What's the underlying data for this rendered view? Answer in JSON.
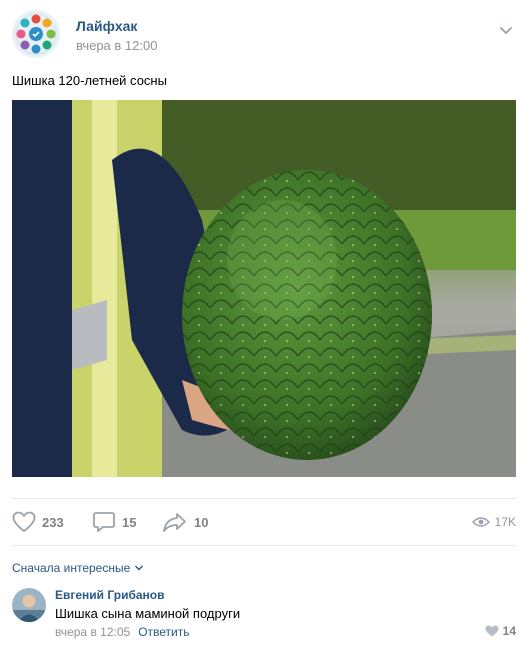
{
  "post": {
    "group_name": "Лайфхак",
    "time": "вчера в 12:00",
    "text": "Шишка 120-летней сосны",
    "photo_icon": "bunya-pine-cone-photo"
  },
  "actions": {
    "likes": "233",
    "comments": "15",
    "shares": "10",
    "views": "17K"
  },
  "comments_section": {
    "sort_label": "Сначала интересные",
    "items": [
      {
        "author": "Евгений Грибанов",
        "text": "Шишка сына маминой подруги",
        "time": "вчера в 12:05",
        "reply_label": "Ответить",
        "likes": "14"
      }
    ]
  },
  "colors": {
    "link": "#2a5885",
    "muted": "#939393",
    "icon": "#99a2ad",
    "divider": "#e7e8ec"
  }
}
